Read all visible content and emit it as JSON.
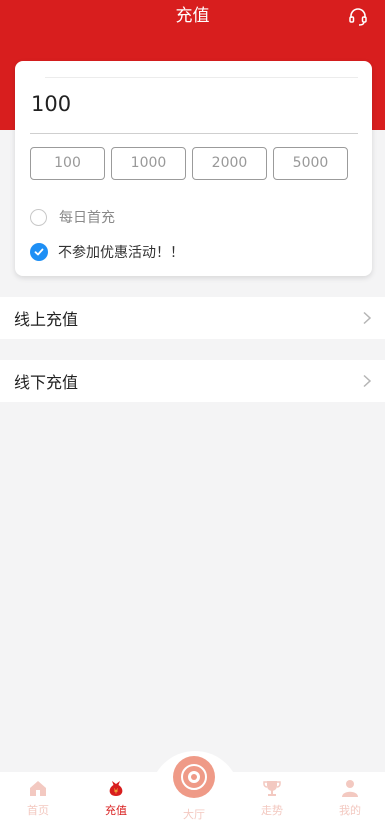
{
  "header": {
    "title": "充值",
    "support_icon": "headset-icon",
    "bg_color": "#d81e1e"
  },
  "recharge": {
    "amount": "100",
    "presets": [
      "100",
      "1000",
      "2000",
      "5000"
    ],
    "options": [
      {
        "label": "每日首充",
        "checked": false
      },
      {
        "label": "不参加优惠活动！！",
        "checked": true
      }
    ]
  },
  "methods": [
    {
      "label": "线上充值"
    },
    {
      "label": "线下充值"
    }
  ],
  "tabbar": {
    "home": "首页",
    "recharge": "充值",
    "lobby": "大厅",
    "trend": "走势",
    "mine": "我的",
    "active": "recharge",
    "active_color": "#d81e1e",
    "inactive_color": "#f3c9c1"
  }
}
